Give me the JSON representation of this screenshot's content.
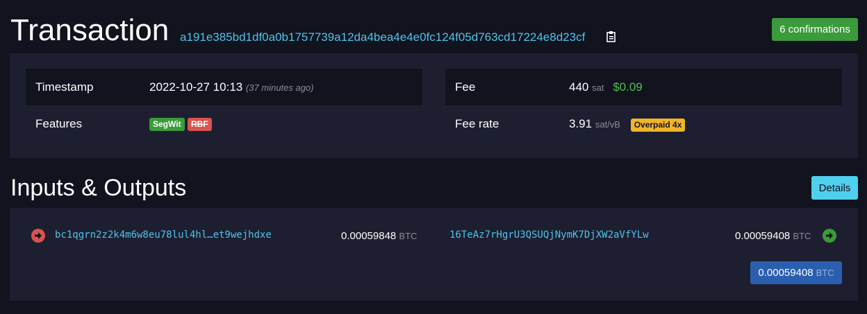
{
  "header": {
    "title": "Transaction",
    "txid": "a191e385bd1df0a0b1757739a12da4bea4e4e0fc124f05d763cd17224e8d23cf",
    "copy_icon": "clipboard-icon",
    "confirmations": "6 confirmations"
  },
  "summary": {
    "timestamp_label": "Timestamp",
    "timestamp_value": "2022-10-27 10:13",
    "timestamp_ago": "(37 minutes ago)",
    "features_label": "Features",
    "feature_segwit": "SegWit",
    "feature_rbf": "RBF",
    "fee_label": "Fee",
    "fee_value": "440",
    "fee_unit": "sat",
    "fee_usd": "$0.09",
    "feerate_label": "Fee rate",
    "feerate_value": "3.91",
    "feerate_unit": "sat/vB",
    "overpaid": "Overpaid 4x"
  },
  "io": {
    "title": "Inputs & Outputs",
    "details_button": "Details",
    "input_address": "bc1qgrn2z2k4m6w8eu78lul4hl…et9wejhdxe",
    "input_amount": "0.00059848",
    "input_unit": "BTC",
    "output_address": "16TeAz7rHgrU3QSUQjNymK7DjXW2aVfYLw",
    "output_amount": "0.00059408",
    "output_unit": "BTC",
    "total_amount": "0.00059408",
    "total_unit": "BTC"
  },
  "colors": {
    "background": "#11131f",
    "panel": "#1d1f31",
    "link": "#4fc3e8",
    "confirm_green": "#3b9a3b",
    "input_red": "#d9534f",
    "output_green": "#3b9a3b",
    "total_blue": "#2a5fb0"
  }
}
